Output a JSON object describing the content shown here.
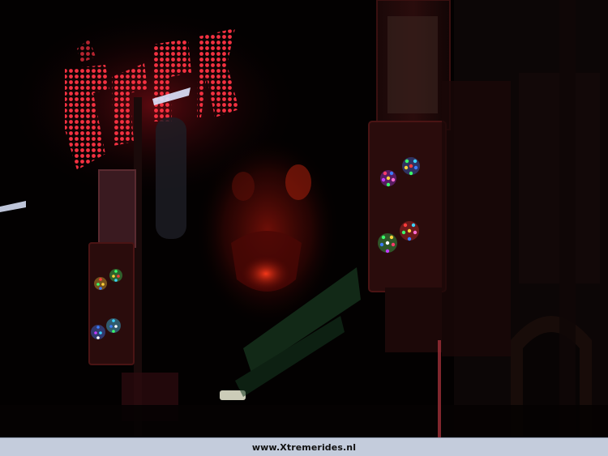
{
  "caption": {
    "site_url": "www.Xtremerides.nl"
  },
  "scene": {
    "sign_glow_color": "#ff2d3a",
    "panel_light_colors": [
      "#ff3b3b",
      "#3bff6a",
      "#3b7bff",
      "#ffd23b",
      "#c43bff"
    ],
    "background_color": "#000000"
  }
}
